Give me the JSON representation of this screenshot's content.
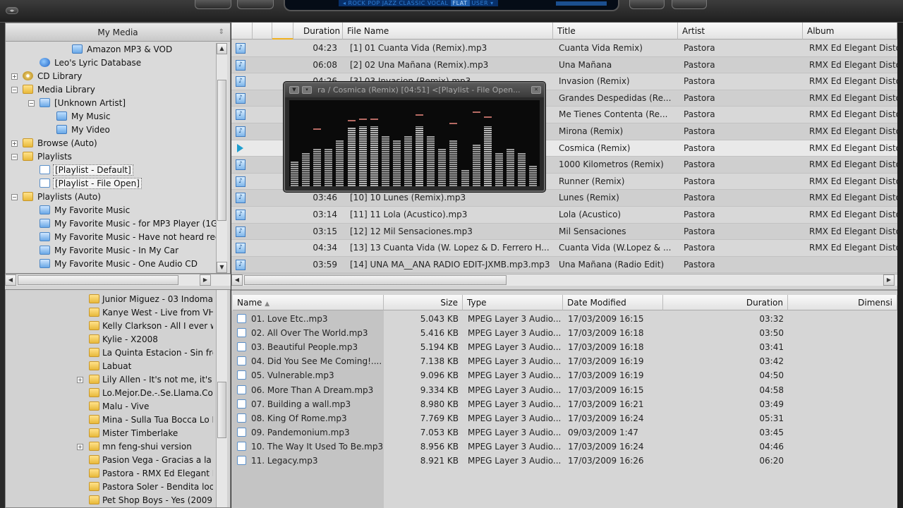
{
  "top": {
    "eq_presets_left": "◂ ROCK  POP  JAZZ  CLASSIC  VOCAL",
    "eq_selected": "FLAT",
    "eq_presets_right": "USER ▾"
  },
  "tree": {
    "header": "My Media",
    "items": [
      {
        "label": "Amazon MP3 & VOD",
        "icon": "note"
      },
      {
        "label": "Leo's Lyric Database",
        "icon": "globe"
      },
      {
        "label": "CD Library",
        "icon": "cd"
      },
      {
        "label": "Media Library",
        "icon": "folder"
      },
      {
        "label": "[Unknown Artist]",
        "icon": "pl"
      },
      {
        "label": "My Music",
        "icon": "note"
      },
      {
        "label": "My Video",
        "icon": "note"
      },
      {
        "label": "Browse (Auto)",
        "icon": "folder"
      },
      {
        "label": "Playlists",
        "icon": "folder"
      },
      {
        "label": "[Playlist - Default]",
        "icon": "doc"
      },
      {
        "label": "[Playlist - File Open]",
        "icon": "doc"
      },
      {
        "label": "Playlists (Auto)",
        "icon": "folder"
      },
      {
        "label": "My Favorite Music",
        "icon": "pl"
      },
      {
        "label": "My Favorite Music - for MP3 Player (1GB",
        "icon": "pl"
      },
      {
        "label": "My Favorite Music - Have not heard rec",
        "icon": "pl"
      },
      {
        "label": "My Favorite Music - In My Car",
        "icon": "pl"
      },
      {
        "label": "My Favorite Music - One Audio CD",
        "icon": "pl"
      }
    ]
  },
  "folders": [
    "Junior Miguez - 03 Indomal",
    "Kanye West - Live from VH",
    "Kelly Clarkson - All I ever w",
    "Kylie - X2008",
    "La Quinta Estacion - Sin fre",
    "Labuat",
    "Lily Allen - It's not me, it's y",
    "Lo.Mejor.De.-.Se.Llama.Co",
    "Malu - Vive",
    "Mina - Sulla Tua Bocca Lo D",
    "Mister Timberlake",
    "mn feng-shui version",
    "Pasion Vega - Gracias a la v",
    "Pastora - RMX Ed Elegant D",
    "Pastora Soler - Bendita locu",
    "Pet Shop Boys - Yes (2009"
  ],
  "playlist": {
    "columns": {
      "duration": "Duration",
      "filename": "File Name",
      "title": "Title",
      "artist": "Artist",
      "album": "Album"
    },
    "rows": [
      {
        "duration": "04:23",
        "filename": "[1] 01 Cuanta Vida (Remix).mp3",
        "title": "Cuanta Vida Remix)",
        "artist": "Pastora",
        "album": "RMX Ed Elegant Distor"
      },
      {
        "duration": "06:08",
        "filename": "[2] 02 Una Mañana (Remix).mp3",
        "title": "Una Mañana",
        "artist": "Pastora",
        "album": "RMX Ed Elegant Distor"
      },
      {
        "duration": "04:26",
        "filename": "[3] 03 Invasion (Remix).mp3",
        "title": "Invasion (Remix)",
        "artist": "Pastora",
        "album": "RMX Ed Elegant Distor"
      },
      {
        "duration": "",
        "filename": "",
        "title": "Grandes Despedidas (Re...",
        "artist": "Pastora",
        "album": "RMX Ed Elegant Distor"
      },
      {
        "duration": "",
        "filename": "",
        "title": "Me Tienes Contenta (Re...",
        "artist": "Pastora",
        "album": "RMX Ed Elegant Distor"
      },
      {
        "duration": "",
        "filename": "",
        "title": "Mirona (Remix)",
        "artist": "Pastora",
        "album": "RMX Ed Elegant Distor"
      },
      {
        "duration": "",
        "filename": "",
        "title": "Cosmica (Remix)",
        "artist": "Pastora",
        "album": "RMX Ed Elegant Distor"
      },
      {
        "duration": "",
        "filename": "",
        "title": "1000 Kilometros (Remix)",
        "artist": "Pastora",
        "album": "RMX Ed Elegant Distor"
      },
      {
        "duration": "",
        "filename": "",
        "title": "Runner (Remix)",
        "artist": "Pastora",
        "album": "RMX Ed Elegant Distor"
      },
      {
        "duration": "03:46",
        "filename": "[10] 10 Lunes (Remix).mp3",
        "title": "Lunes (Remix)",
        "artist": "Pastora",
        "album": "RMX Ed Elegant Distor"
      },
      {
        "duration": "03:14",
        "filename": "[11] 11 Lola (Acustico).mp3",
        "title": "Lola (Acustico)",
        "artist": "Pastora",
        "album": "RMX Ed Elegant Distor"
      },
      {
        "duration": "03:15",
        "filename": "[12] 12 Mil Sensaciones.mp3",
        "title": "Mil Sensaciones",
        "artist": "Pastora",
        "album": "RMX Ed Elegant Distor"
      },
      {
        "duration": "04:34",
        "filename": "[13] 13 Cuanta Vida (W. Lopez & D. Ferrero H...",
        "title": "Cuanta Vida (W.Lopez & ...",
        "artist": "Pastora",
        "album": "RMX Ed Elegant Distor"
      },
      {
        "duration": "03:59",
        "filename": "[14] UNA MA__ANA RADIO EDIT-JXMB.mp3.mp3",
        "title": "Una Mañana (Radio Edit)",
        "artist": "Pastora",
        "album": ""
      }
    ]
  },
  "visualizer": {
    "title": "ra / Cosmica (Remix)  [04:51]     <[Playlist - File Open...",
    "levels": [
      0.3,
      0.4,
      0.45,
      0.45,
      0.55,
      0.7,
      0.72,
      0.72,
      0.6,
      0.55,
      0.6,
      0.72,
      0.6,
      0.45,
      0.55,
      0.2,
      0.5,
      0.72,
      0.4,
      0.45,
      0.4,
      0.25
    ],
    "peaks": [
      0,
      0,
      0.68,
      0,
      0,
      0.78,
      0.8,
      0.8,
      0,
      0,
      0,
      0.85,
      0,
      0,
      0.75,
      0,
      0.88,
      0.82,
      0,
      0,
      0,
      0
    ]
  },
  "browser": {
    "columns": {
      "name": "Name",
      "size": "Size",
      "type": "Type",
      "date": "Date Modified",
      "duration": "Duration",
      "dimension": "Dimensi"
    },
    "rows": [
      {
        "name": "01. Love Etc..mp3",
        "size": "5.043 KB",
        "type": "MPEG Layer 3 Audio...",
        "date": "17/03/2009 16:15",
        "duration": "03:32"
      },
      {
        "name": "02. All Over The World.mp3",
        "size": "5.416 KB",
        "type": "MPEG Layer 3 Audio...",
        "date": "17/03/2009 16:18",
        "duration": "03:50"
      },
      {
        "name": "03. Beautiful People.mp3",
        "size": "5.194 KB",
        "type": "MPEG Layer 3 Audio...",
        "date": "17/03/2009 16:18",
        "duration": "03:41"
      },
      {
        "name": "04. Did You See Me Coming!....",
        "size": "7.138 KB",
        "type": "MPEG Layer 3 Audio...",
        "date": "17/03/2009 16:19",
        "duration": "03:42"
      },
      {
        "name": "05. Vulnerable.mp3",
        "size": "9.096 KB",
        "type": "MPEG Layer 3 Audio...",
        "date": "17/03/2009 16:19",
        "duration": "04:50"
      },
      {
        "name": "06. More Than A Dream.mp3",
        "size": "9.334 KB",
        "type": "MPEG Layer 3 Audio...",
        "date": "17/03/2009 16:15",
        "duration": "04:58"
      },
      {
        "name": "07. Building a wall.mp3",
        "size": "8.980 KB",
        "type": "MPEG Layer 3 Audio...",
        "date": "17/03/2009 16:21",
        "duration": "03:49"
      },
      {
        "name": "08. King Of Rome.mp3",
        "size": "7.769 KB",
        "type": "MPEG Layer 3 Audio...",
        "date": "17/03/2009 16:24",
        "duration": "05:31"
      },
      {
        "name": "09. Pandemonium.mp3",
        "size": "7.053 KB",
        "type": "MPEG Layer 3 Audio...",
        "date": "09/03/2009 1:47",
        "duration": "03:45"
      },
      {
        "name": "10. The Way It Used To Be.mp3",
        "size": "8.956 KB",
        "type": "MPEG Layer 3 Audio...",
        "date": "17/03/2009 16:24",
        "duration": "04:46"
      },
      {
        "name": "11. Legacy.mp3",
        "size": "8.921 KB",
        "type": "MPEG Layer 3 Audio...",
        "date": "17/03/2009 16:26",
        "duration": "06:20"
      }
    ]
  }
}
